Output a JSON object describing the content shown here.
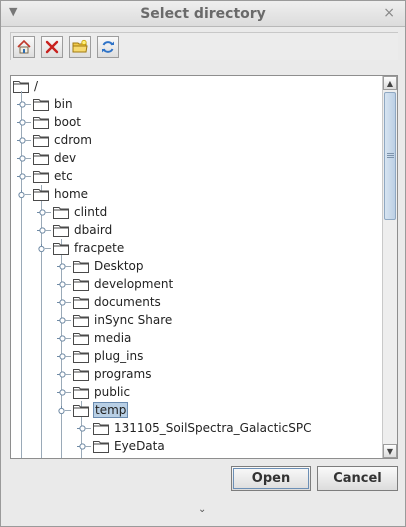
{
  "window": {
    "title": "Select directory",
    "menu_glyph": "▼",
    "close_glyph": "×"
  },
  "toolbar": [
    {
      "name": "home-icon"
    },
    {
      "name": "delete-icon"
    },
    {
      "name": "new-folder-icon"
    },
    {
      "name": "refresh-icon"
    }
  ],
  "tree": {
    "root": "/",
    "nodes": [
      {
        "label": "bin",
        "depth": 1
      },
      {
        "label": "boot",
        "depth": 1
      },
      {
        "label": "cdrom",
        "depth": 1
      },
      {
        "label": "dev",
        "depth": 1
      },
      {
        "label": "etc",
        "depth": 1
      },
      {
        "label": "home",
        "depth": 1,
        "expanded": true
      },
      {
        "label": "clintd",
        "depth": 2
      },
      {
        "label": "dbaird",
        "depth": 2
      },
      {
        "label": "fracpete",
        "depth": 2,
        "expanded": true
      },
      {
        "label": "Desktop",
        "depth": 3
      },
      {
        "label": "development",
        "depth": 3
      },
      {
        "label": "documents",
        "depth": 3
      },
      {
        "label": "inSync Share",
        "depth": 3
      },
      {
        "label": "media",
        "depth": 3
      },
      {
        "label": "plug_ins",
        "depth": 3
      },
      {
        "label": "programs",
        "depth": 3
      },
      {
        "label": "public",
        "depth": 3
      },
      {
        "label": "temp",
        "depth": 3,
        "expanded": true,
        "selected": true
      },
      {
        "label": "131105_SoilSpectra_GalacticSPC",
        "depth": 4
      },
      {
        "label": "EyeData",
        "depth": 4
      },
      {
        "label": "",
        "depth": 4
      }
    ]
  },
  "scrollbar": {
    "up_glyph": "▲",
    "down_glyph": "▼"
  },
  "buttons": {
    "open": "Open",
    "cancel": "Cancel"
  },
  "expander_glyph": "⌄"
}
